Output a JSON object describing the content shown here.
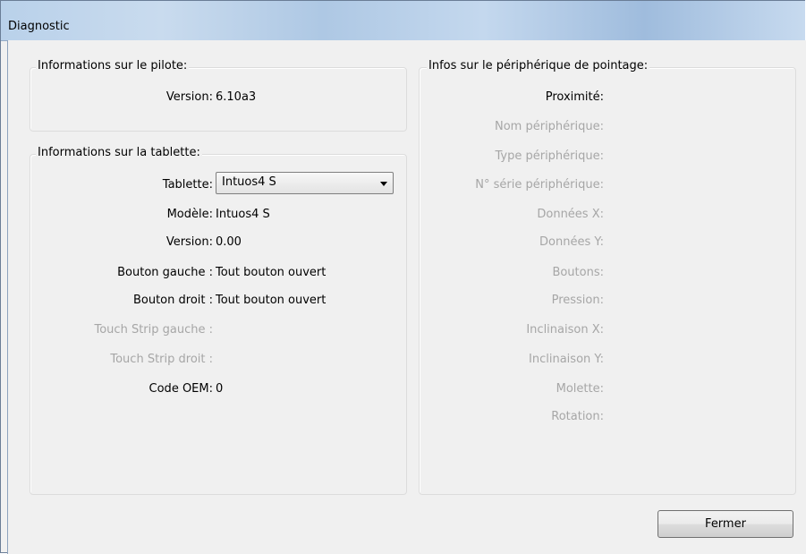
{
  "window": {
    "title": "Diagnostic"
  },
  "driver_group": {
    "legend": "Informations sur le pilote:",
    "version_label": "Version:",
    "version_value": "6.10a3"
  },
  "tablet_group": {
    "legend": "Informations sur la tablette:",
    "tablet_label": "Tablette:",
    "tablet_selected": "Intuos4 S",
    "rows": [
      {
        "label": "Modèle:",
        "value": "Intuos4 S"
      },
      {
        "label": "Version:",
        "value": "0.00"
      },
      {
        "label": "Bouton gauche :",
        "value": "Tout bouton ouvert"
      },
      {
        "label": "Bouton droit :",
        "value": "Tout bouton ouvert"
      },
      {
        "label": "Touch Strip gauche :",
        "value": ""
      },
      {
        "label": "Touch Strip droit :",
        "value": ""
      },
      {
        "label": "Code OEM:",
        "value": "0"
      }
    ]
  },
  "pointer_group": {
    "legend": "Infos sur le périphérique de pointage:",
    "rows": [
      {
        "label": "Proximité:"
      },
      {
        "label": "Nom périphérique:"
      },
      {
        "label": "Type périphérique:"
      },
      {
        "label": "N° série périphérique:"
      },
      {
        "label": "Données X:"
      },
      {
        "label": "Données Y:"
      },
      {
        "label": "Boutons:"
      },
      {
        "label": "Pression:"
      },
      {
        "label": "Inclinaison X:"
      },
      {
        "label": "Inclinaison Y:"
      },
      {
        "label": "Molette:"
      },
      {
        "label": "Rotation:"
      }
    ]
  },
  "buttons": {
    "close_label": "Fermer"
  }
}
